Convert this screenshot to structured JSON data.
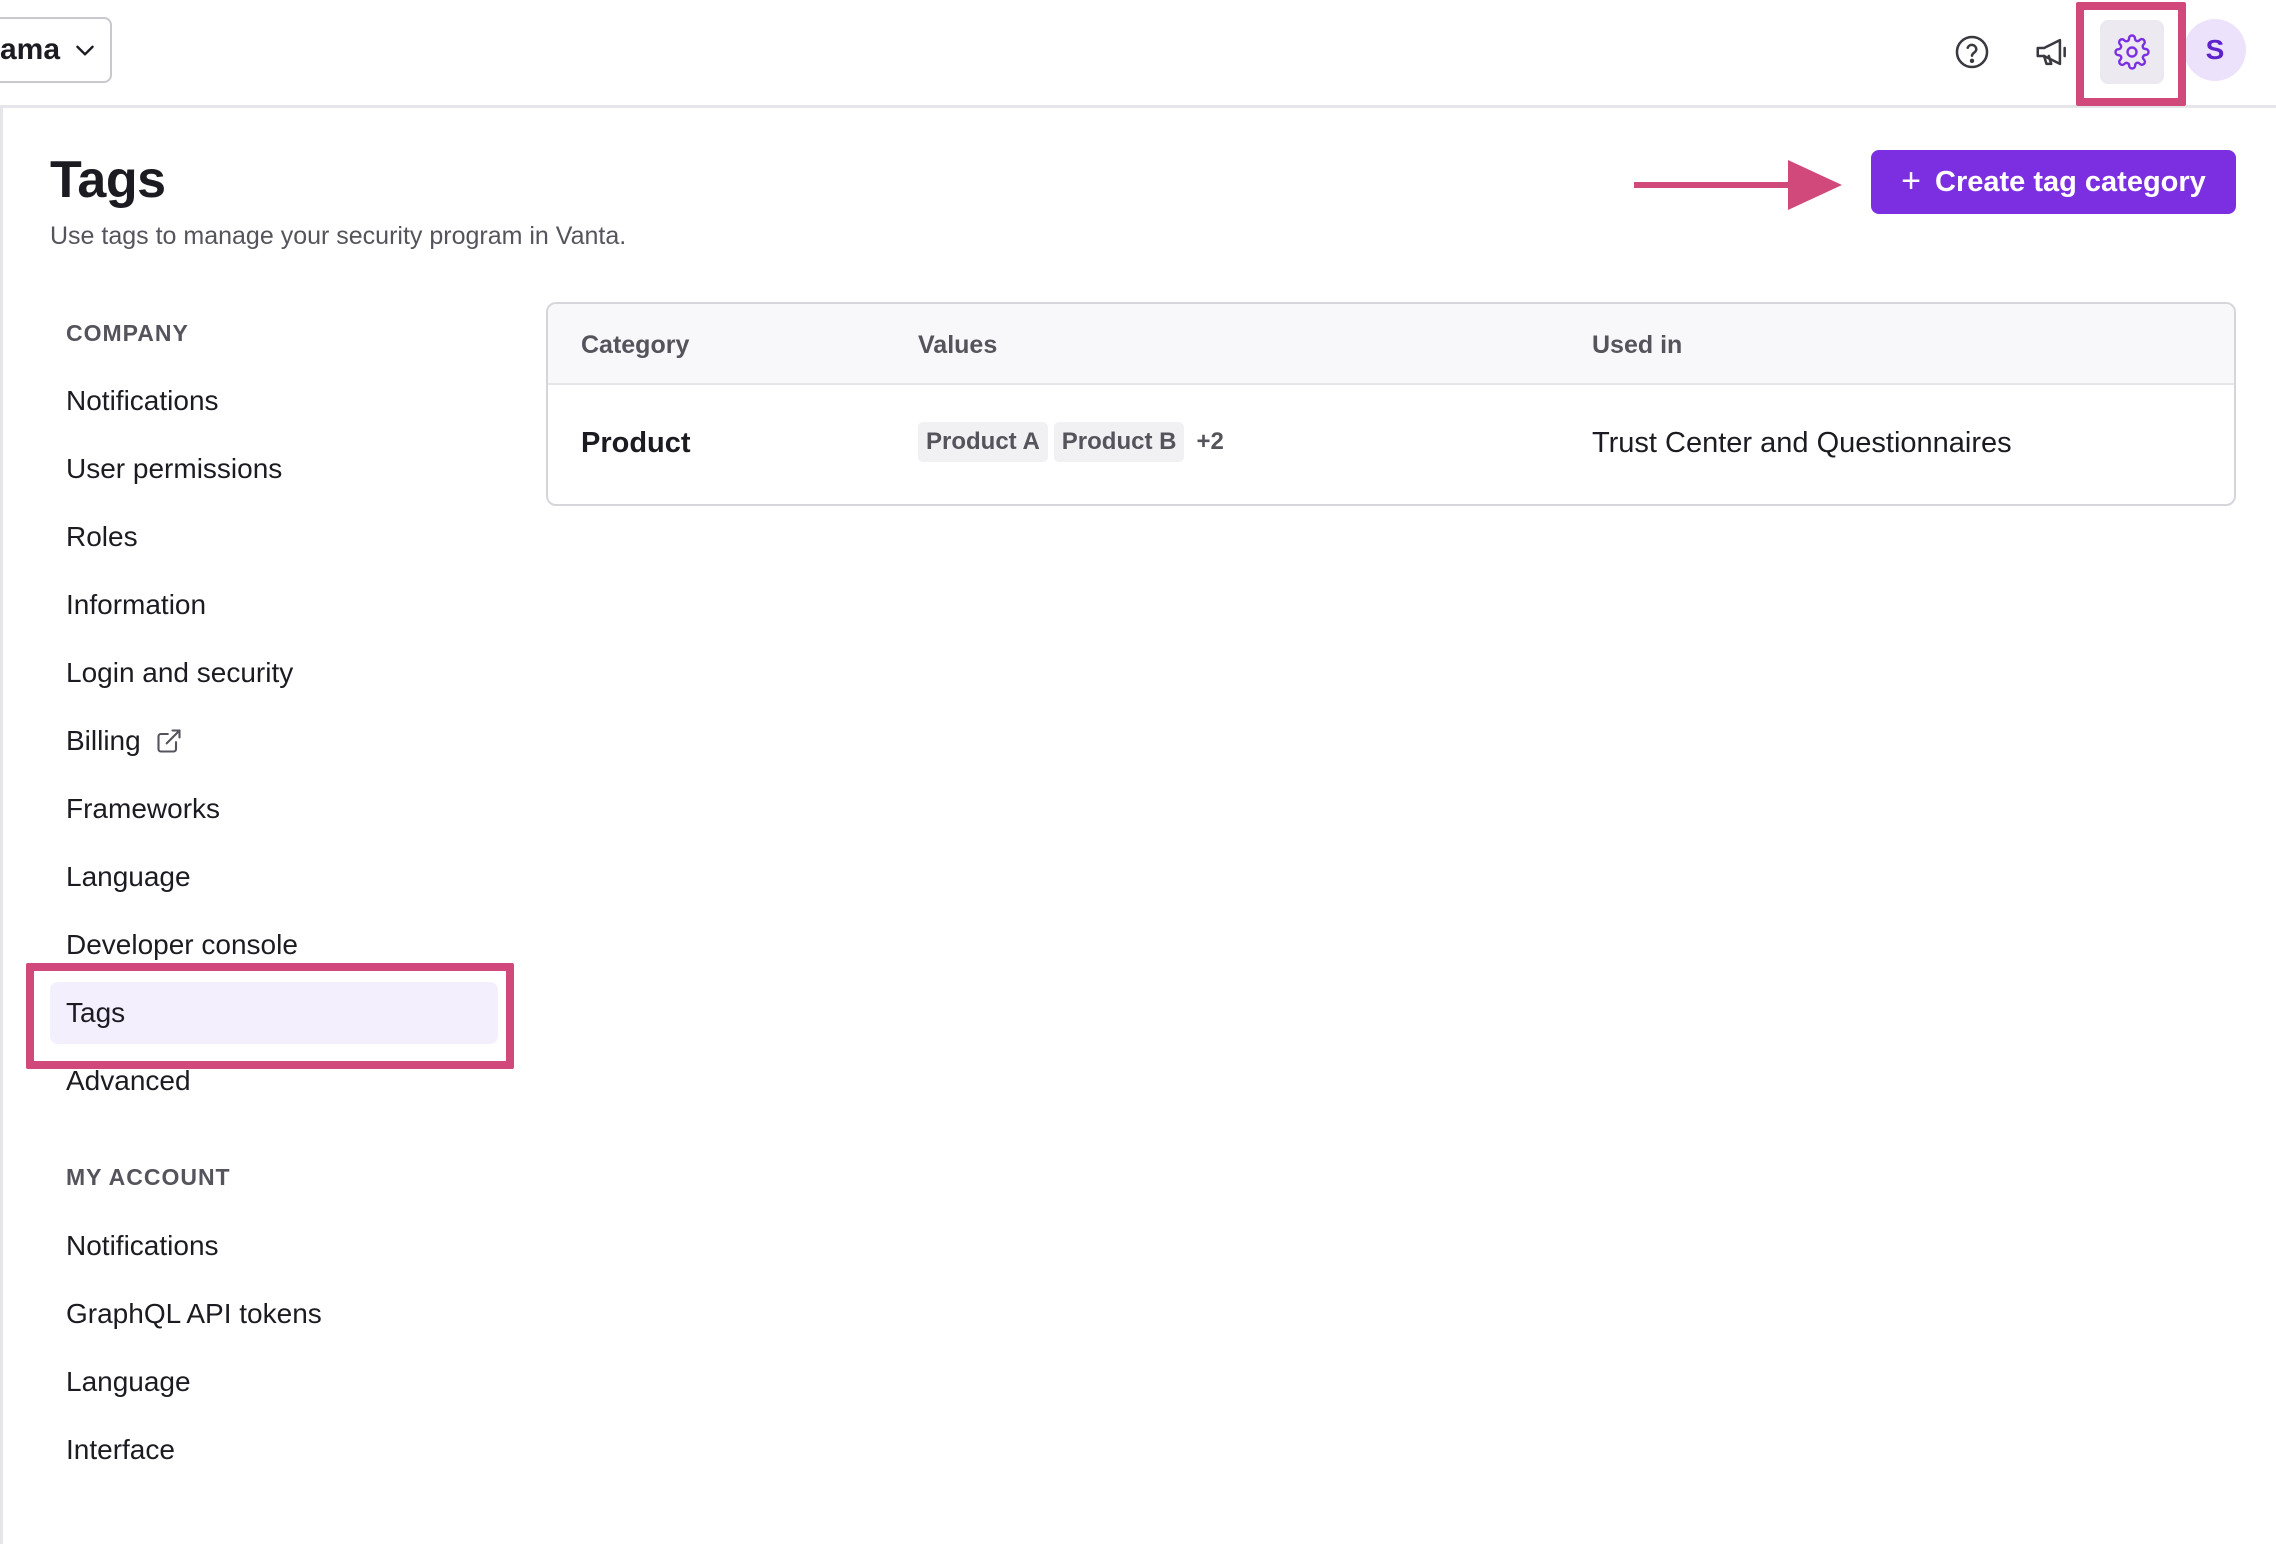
{
  "topbar": {
    "workspace_name": "ama",
    "avatar_initial": "S",
    "icons": [
      "help-icon",
      "megaphone-icon",
      "gear-icon",
      "chevron-down-icon"
    ]
  },
  "header": {
    "title": "Tags",
    "subtitle": "Use tags to manage your security program in Vanta.",
    "create_button_label": "Create tag category"
  },
  "sidebar": {
    "company_heading": "COMPANY",
    "company_items": [
      {
        "label": "Notifications"
      },
      {
        "label": "User permissions"
      },
      {
        "label": "Roles"
      },
      {
        "label": "Information"
      },
      {
        "label": "Login and security"
      },
      {
        "label": "Billing"
      },
      {
        "label": "Frameworks"
      },
      {
        "label": "Language"
      },
      {
        "label": "Developer console"
      },
      {
        "label": "Tags"
      },
      {
        "label": "Advanced"
      }
    ],
    "account_heading": "MY ACCOUNT",
    "account_items": [
      {
        "label": "Notifications"
      },
      {
        "label": "GraphQL API tokens"
      },
      {
        "label": "Language"
      },
      {
        "label": "Interface"
      }
    ]
  },
  "table": {
    "columns": [
      "Category",
      "Values",
      "Used in"
    ],
    "rows": [
      {
        "category": "Product",
        "values": [
          "Product A",
          "Product B"
        ],
        "more": "+2",
        "used_in": "Trust Center and Questionnaires"
      }
    ]
  },
  "colors": {
    "accent": "#7b2fe0",
    "annotation": "#d1497a",
    "active_nav_bg": "#f4effd"
  }
}
